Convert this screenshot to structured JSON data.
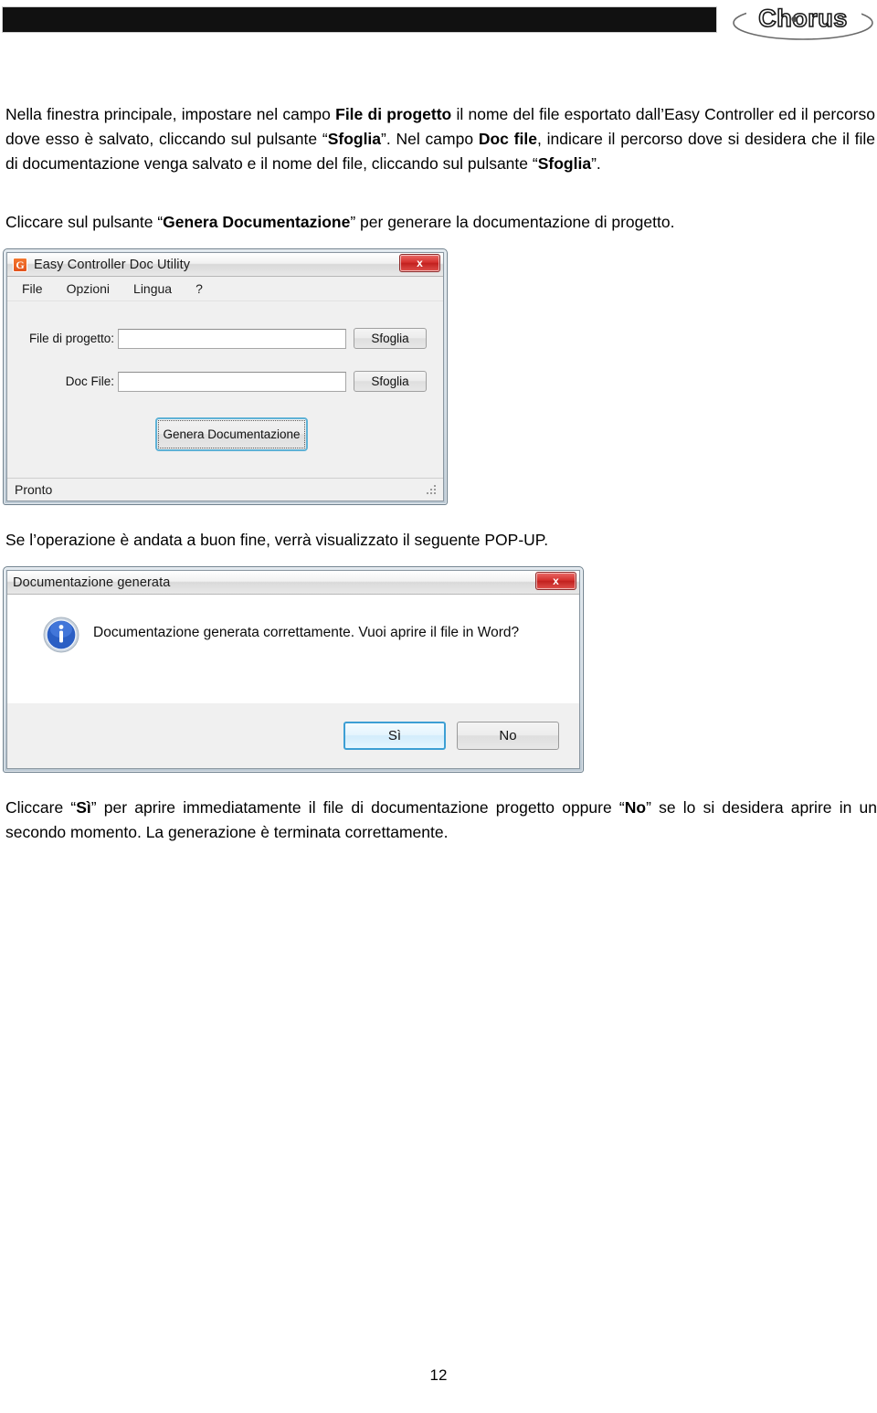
{
  "header": {
    "band_color": "#111111",
    "brand_name": "Chorus"
  },
  "paragraphs": {
    "p1_a": "Nella finestra principale, impostare nel campo ",
    "p1_b1": "File di progetto",
    "p1_c": " il nome del file esportato dall’Easy Controller ed il percorso dove esso è salvato, cliccando sul pulsante “",
    "p1_b2": "Sfoglia",
    "p1_d": "”. Nel campo ",
    "p1_b3": "Doc file",
    "p1_e": ", indicare il percorso dove si desidera che il file di documentazione venga salvato e il nome del file, cliccando sul pulsante “",
    "p1_b4": "Sfoglia",
    "p1_f": "”.",
    "p2_a": "Cliccare sul pulsante “",
    "p2_b1": "Genera Documentazione",
    "p2_c": "” per generare la documentazione di progetto.",
    "p3": "Se l’operazione è andata a buon fine, verrà visualizzato il seguente POP-UP.",
    "p4_a": "Cliccare “",
    "p4_b1": "Sì",
    "p4_c": "” per aprire immediatamente il file di documentazione progetto oppure “",
    "p4_b2": "No",
    "p4_d": "” se lo si desidera aprire in un secondo momento. La generazione è terminata correttamente."
  },
  "doc_utility_window": {
    "title": "Easy Controller Doc Utility",
    "app_icon_letter": "G",
    "close_label": "x",
    "menu": [
      {
        "label": "File"
      },
      {
        "label": "Opzioni"
      },
      {
        "label": "Lingua"
      },
      {
        "label": "?"
      }
    ],
    "fields": [
      {
        "label": "File di progetto:",
        "value": "",
        "placeholder": "",
        "button": "Sfoglia"
      },
      {
        "label": "Doc File:",
        "value": "",
        "placeholder": "",
        "button": "Sfoglia"
      }
    ],
    "generate_button": "Genera Documentazione",
    "status_text": "Pronto"
  },
  "popup_window": {
    "title": "Documentazione generata",
    "close_label": "x",
    "icon": "info-icon",
    "message": "Documentazione generata correttamente.  Vuoi aprire il file in Word?",
    "buttons": [
      {
        "label": "Sì",
        "default": true
      },
      {
        "label": "No",
        "default": false
      }
    ]
  },
  "footer": {
    "page_number": "12"
  }
}
